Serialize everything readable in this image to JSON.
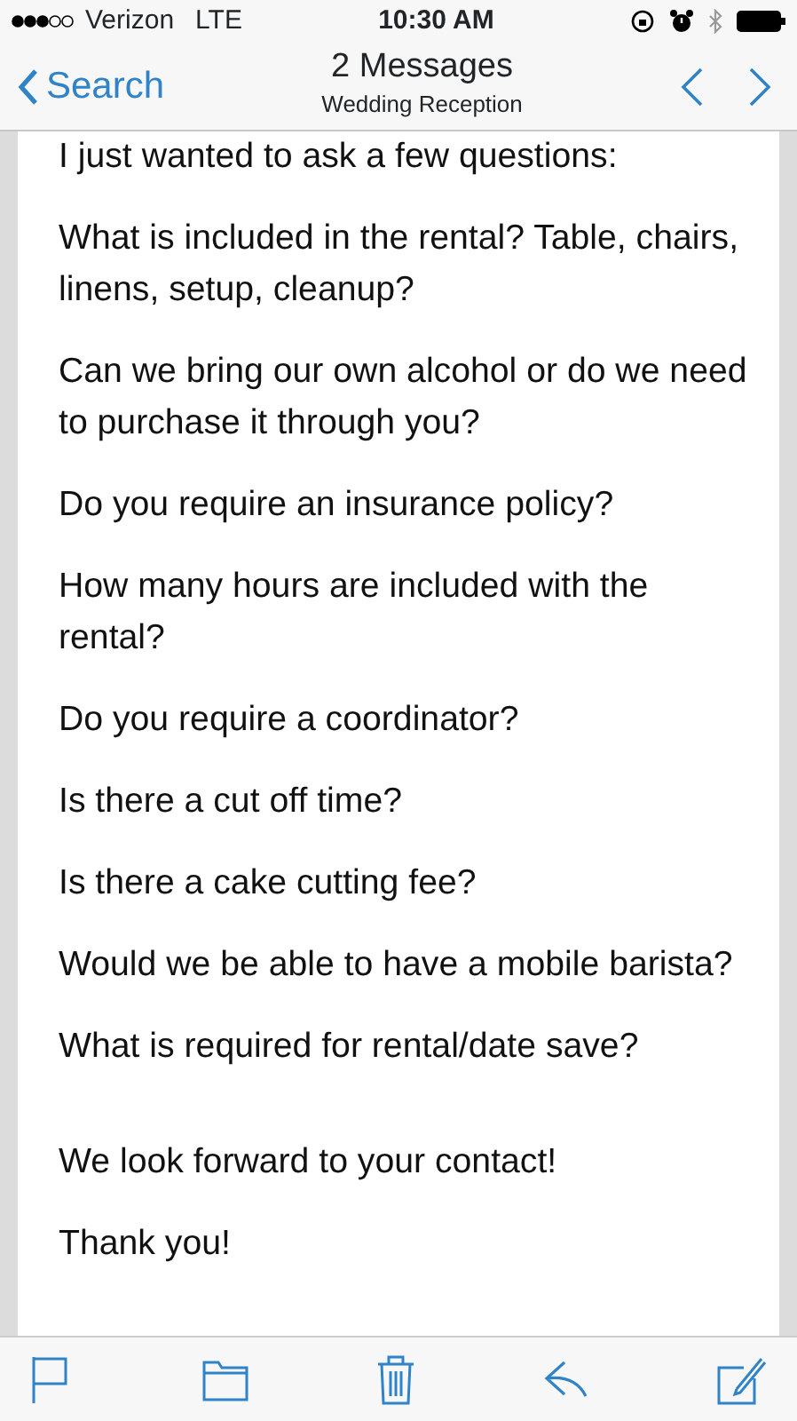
{
  "status_bar": {
    "carrier": "Verizon",
    "network": "LTE",
    "time": "10:30 AM"
  },
  "nav": {
    "back_label": "Search",
    "title": "2 Messages",
    "subtitle": "Wedding Reception"
  },
  "body": {
    "paragraphs": [
      {
        "text": "I just wanted to ask a few questions:"
      },
      {
        "text": "What is included in the rental? Table, chairs, linens, setup, cleanup?"
      },
      {
        "text": "Can we bring our own alcohol or do we need to purchase it through you?"
      },
      {
        "text": "Do you require an insurance policy?"
      },
      {
        "text": "How many hours are included with the rental?"
      },
      {
        "text": "Do you require a coordinator?"
      },
      {
        "text": "Is there a cut off time?"
      },
      {
        "text": "Is there a cake cutting fee?"
      },
      {
        "text": "Would we be able to have a mobile barista?"
      },
      {
        "text": "What is required for rental/date save?"
      },
      {
        "text": "We look forward to your contact!",
        "extra_space_before": true
      },
      {
        "text": "Thank you!"
      }
    ]
  },
  "toolbar": [
    {
      "kind": "flag"
    },
    {
      "kind": "folder"
    },
    {
      "kind": "trash"
    },
    {
      "kind": "reply"
    },
    {
      "kind": "compose"
    }
  ]
}
